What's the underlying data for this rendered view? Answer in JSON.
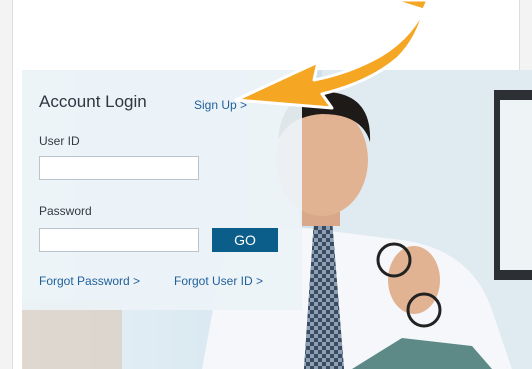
{
  "login": {
    "title": "Account Login",
    "signup_label": "Sign Up >",
    "user_id_label": "User ID",
    "user_id_value": "",
    "password_label": "Password",
    "password_value": "",
    "go_label": "GO",
    "forgot_password_label": "Forgot Password >",
    "forgot_user_id_label": "Forgot User ID >"
  },
  "icons": {
    "annotation_arrow": "curved-arrow-icon"
  },
  "colors": {
    "accent": "#f5a623",
    "link": "#1f5f9a",
    "button": "#0b5e8a",
    "panel": "#ecf3f8"
  }
}
